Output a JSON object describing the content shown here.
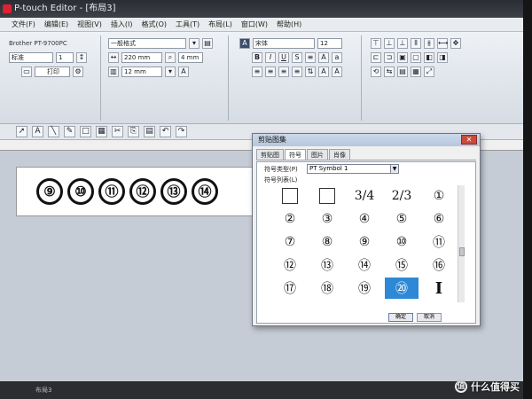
{
  "window": {
    "title": "P-touch Editor - [布局3]"
  },
  "menu": [
    "文件(F)",
    "编辑(E)",
    "视图(V)",
    "插入(I)",
    "格式(O)",
    "工具(T)",
    "布局(L)",
    "窗口(W)",
    "帮助(H)"
  ],
  "printer_panel": {
    "printer": "Brother PT-9700PC",
    "mode": "标准",
    "copies": "1",
    "print_button": "打印"
  },
  "paper_panel": {
    "format": "一般格式",
    "length": "220 mm",
    "margin": "4 mm",
    "tape_width": "12 mm"
  },
  "font_panel": {
    "font": "宋体",
    "size": "12"
  },
  "label": {
    "numbers": [
      "⑨",
      "⑩",
      "⑪",
      "⑫",
      "⑬",
      "⑭"
    ]
  },
  "dialog": {
    "title": "剪贴图集",
    "tabs": [
      "剪贴图",
      "符号",
      "图片",
      "肖像"
    ],
    "active_tab": "符号",
    "symbol_type_label": "符号类型(P)",
    "symbol_type_value": "PT Symbol 1",
    "symbol_list_label": "符号列表(L)",
    "symbols": [
      "□",
      "□",
      "3/4",
      "2/3",
      "①",
      "②",
      "③",
      "④",
      "⑤",
      "⑥",
      "⑦",
      "⑧",
      "⑨",
      "⑩",
      "⑪",
      "⑫",
      "⑬",
      "⑭",
      "⑮",
      "⑯",
      "⑰",
      "⑱",
      "⑲",
      "⑳",
      "I"
    ],
    "selected_symbol": "⑳",
    "ok_label": "确定",
    "cancel_label": "取消",
    "close_label": "✕"
  },
  "status": {
    "text": "布局3"
  },
  "watermark": {
    "text": "什么值得买",
    "icon_text": "值"
  }
}
